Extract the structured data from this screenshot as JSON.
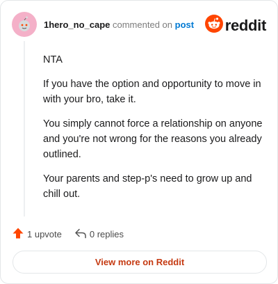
{
  "header": {
    "username": "1hero_no_cape",
    "commented_text": "commented on",
    "post_link": "post",
    "avatar_icon": "snoo-avatar-icon",
    "avatar_color": "#f4b0c8",
    "brand_icon": "reddit-logo-icon",
    "brand_text": "reddit",
    "brand_color": "#ff4500"
  },
  "comment": {
    "paragraphs": [
      "NTA",
      "If you have the option and opportunity to move in with your bro, take it.",
      "You simply cannot force a relationship on anyone and you're not wrong for the reasons you already outlined.",
      "Your parents and step-p's need to grow up and chill out."
    ]
  },
  "actions": {
    "upvote_label": "1 upvote",
    "upvote_icon": "upvote-arrow-icon",
    "replies_label": "0 replies",
    "replies_icon": "reply-icon"
  },
  "footer": {
    "view_more_label": "View more on Reddit"
  }
}
